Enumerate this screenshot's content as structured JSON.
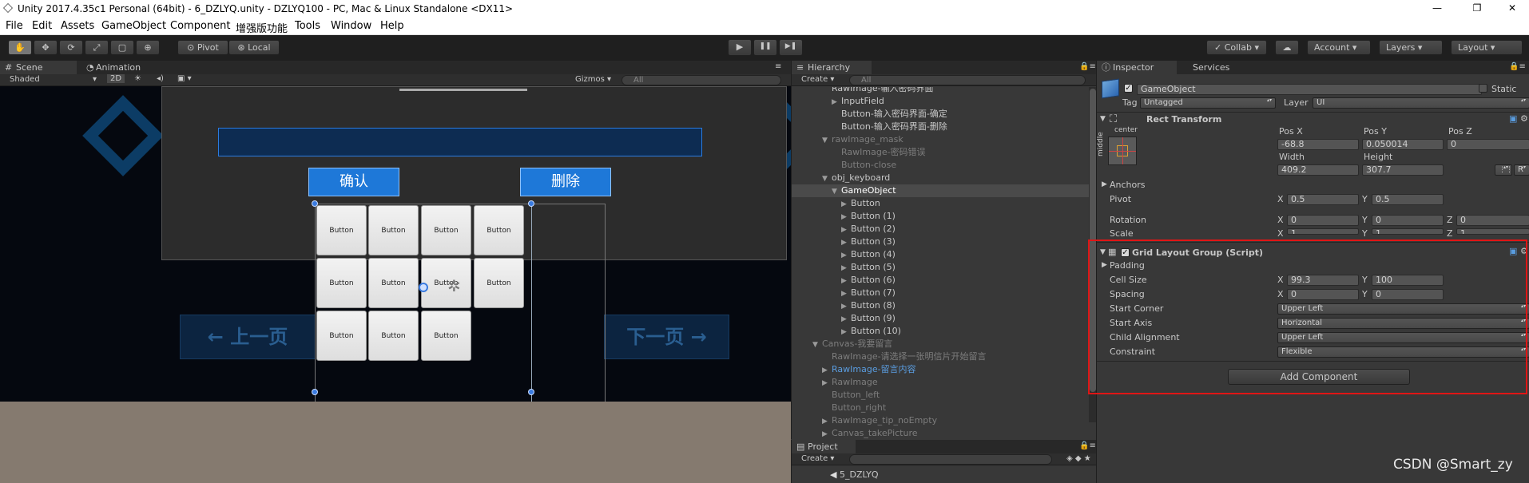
{
  "window": {
    "title": "Unity 2017.4.35c1 Personal (64bit) - 6_DZLYQ.unity - DZLYQ100 - PC, Mac & Linux Standalone <DX11>",
    "minimize": "—",
    "maximize": "❐",
    "close": "✕"
  },
  "menu": [
    "File",
    "Edit",
    "Assets",
    "GameObject",
    "Component",
    "增强版功能",
    "Tools",
    "Window",
    "Help"
  ],
  "toolbar": {
    "tools": [
      "hand-icon",
      "move-icon",
      "rotate-icon",
      "scale-icon",
      "rect-icon",
      "transform-icon"
    ],
    "pivot": "Pivot",
    "local": "Local",
    "play": "▶",
    "pause": "❚❚",
    "step": "▶❚",
    "collab": "Collab ▾",
    "cloud": "☁",
    "account": "Account",
    "layers": "Layers",
    "layout": "Layout"
  },
  "scene": {
    "tabs": [
      "Scene",
      "Animation"
    ],
    "shading": "Shaded",
    "mode2d": "2D",
    "gizmos": "Gizmos",
    "search_placeholder": "All",
    "confirm_label": "确认",
    "delete_label": "删除",
    "keyboard_buttons": [
      "Button",
      "Button",
      "Button",
      "Button",
      "Button",
      "Button",
      "Button",
      "Button",
      "Button",
      "Button",
      "Button"
    ],
    "prev_page": "上一页",
    "next_page": "下一页"
  },
  "hierarchy": {
    "tab": "Hierarchy",
    "create": "Create",
    "search_placeholder": "All",
    "rows": [
      {
        "label": "RawImage-输入密码界面",
        "indent": 4,
        "arrow": "",
        "style": "normal"
      },
      {
        "label": "InputField",
        "indent": 5,
        "arrow": "▶",
        "style": "normal"
      },
      {
        "label": "Button-输入密码界面-确定",
        "indent": 5,
        "arrow": "",
        "style": "normal"
      },
      {
        "label": "Button-输入密码界面-删除",
        "indent": 5,
        "arrow": "",
        "style": "normal"
      },
      {
        "label": "rawImage_mask",
        "indent": 4,
        "arrow": "▼",
        "style": "dim"
      },
      {
        "label": "RawImage-密码错误",
        "indent": 5,
        "arrow": "",
        "style": "dim"
      },
      {
        "label": "Button-close",
        "indent": 5,
        "arrow": "",
        "style": "dim"
      },
      {
        "label": "obj_keyboard",
        "indent": 4,
        "arrow": "▼",
        "style": "normal"
      },
      {
        "label": "GameObject",
        "indent": 5,
        "arrow": "▼",
        "style": "selected"
      },
      {
        "label": "Button",
        "indent": 6,
        "arrow": "▶",
        "style": "normal"
      },
      {
        "label": "Button (1)",
        "indent": 6,
        "arrow": "▶",
        "style": "normal"
      },
      {
        "label": "Button (2)",
        "indent": 6,
        "arrow": "▶",
        "style": "normal"
      },
      {
        "label": "Button (3)",
        "indent": 6,
        "arrow": "▶",
        "style": "normal"
      },
      {
        "label": "Button (4)",
        "indent": 6,
        "arrow": "▶",
        "style": "normal"
      },
      {
        "label": "Button (5)",
        "indent": 6,
        "arrow": "▶",
        "style": "normal"
      },
      {
        "label": "Button (6)",
        "indent": 6,
        "arrow": "▶",
        "style": "normal"
      },
      {
        "label": "Button (7)",
        "indent": 6,
        "arrow": "▶",
        "style": "normal"
      },
      {
        "label": "Button (8)",
        "indent": 6,
        "arrow": "▶",
        "style": "normal"
      },
      {
        "label": "Button (9)",
        "indent": 6,
        "arrow": "▶",
        "style": "normal"
      },
      {
        "label": "Button (10)",
        "indent": 6,
        "arrow": "▶",
        "style": "normal"
      },
      {
        "label": "Canvas-我要留言",
        "indent": 3,
        "arrow": "▼",
        "style": "dim"
      },
      {
        "label": "RawImage-请选择一张明信片开始留言",
        "indent": 4,
        "arrow": "",
        "style": "dim"
      },
      {
        "label": "RawImage-留言内容",
        "indent": 4,
        "arrow": "▶",
        "style": "blue"
      },
      {
        "label": "RawImage",
        "indent": 4,
        "arrow": "▶",
        "style": "dim"
      },
      {
        "label": "Button_left",
        "indent": 4,
        "arrow": "",
        "style": "dim"
      },
      {
        "label": "Button_right",
        "indent": 4,
        "arrow": "",
        "style": "dim"
      },
      {
        "label": "RawImage_tip_noEmpty",
        "indent": 4,
        "arrow": "▶",
        "style": "dim"
      },
      {
        "label": "Canvas_takePicture",
        "indent": 4,
        "arrow": "▶",
        "style": "dim"
      }
    ]
  },
  "project": {
    "tab": "Project",
    "create": "Create",
    "item": "5_DZLYQ"
  },
  "inspector": {
    "tabs": [
      "Inspector",
      "Services"
    ],
    "object_name": "GameObject",
    "static_label": "Static",
    "tag_label": "Tag",
    "tag_value": "Untagged",
    "layer_label": "Layer",
    "layer_value": "UI",
    "rect_transform": {
      "title": "Rect Transform",
      "anchor_h": "center",
      "anchor_v": "middle",
      "headers": [
        "Pos X",
        "Pos Y",
        "Pos Z"
      ],
      "pos": [
        "-68.8",
        "0.050014",
        "0"
      ],
      "size_headers": [
        "Width",
        "Height"
      ],
      "size": [
        "409.2",
        "307.7"
      ],
      "raw_label": "R",
      "anchors": "Anchors",
      "pivot": "Pivot",
      "pivot_values": [
        "0.5",
        "0.5"
      ],
      "rotation": "Rotation",
      "rotation_values": [
        "0",
        "0",
        "0"
      ],
      "scale": "Scale",
      "scale_values": [
        "1",
        "1",
        "1"
      ]
    },
    "grid_layout": {
      "title": "Grid Layout Group (Script)",
      "padding": "Padding",
      "cell_size_label": "Cell Size",
      "cell_size": [
        "99.3",
        "100"
      ],
      "spacing_label": "Spacing",
      "spacing": [
        "0",
        "0"
      ],
      "start_corner_label": "Start Corner",
      "start_corner": "Upper Left",
      "start_axis_label": "Start Axis",
      "start_axis": "Horizontal",
      "child_alignment_label": "Child Alignment",
      "child_alignment": "Upper Left",
      "constraint_label": "Constraint",
      "constraint": "Flexible"
    },
    "axis": {
      "x": "X",
      "y": "Y",
      "z": "Z"
    },
    "add_component": "Add Component"
  },
  "watermark": "CSDN @Smart_zy",
  "colors": {
    "highlight_box": "#e01515",
    "selection": "#4a4a4a",
    "unity_blue": "#1e78d8"
  }
}
